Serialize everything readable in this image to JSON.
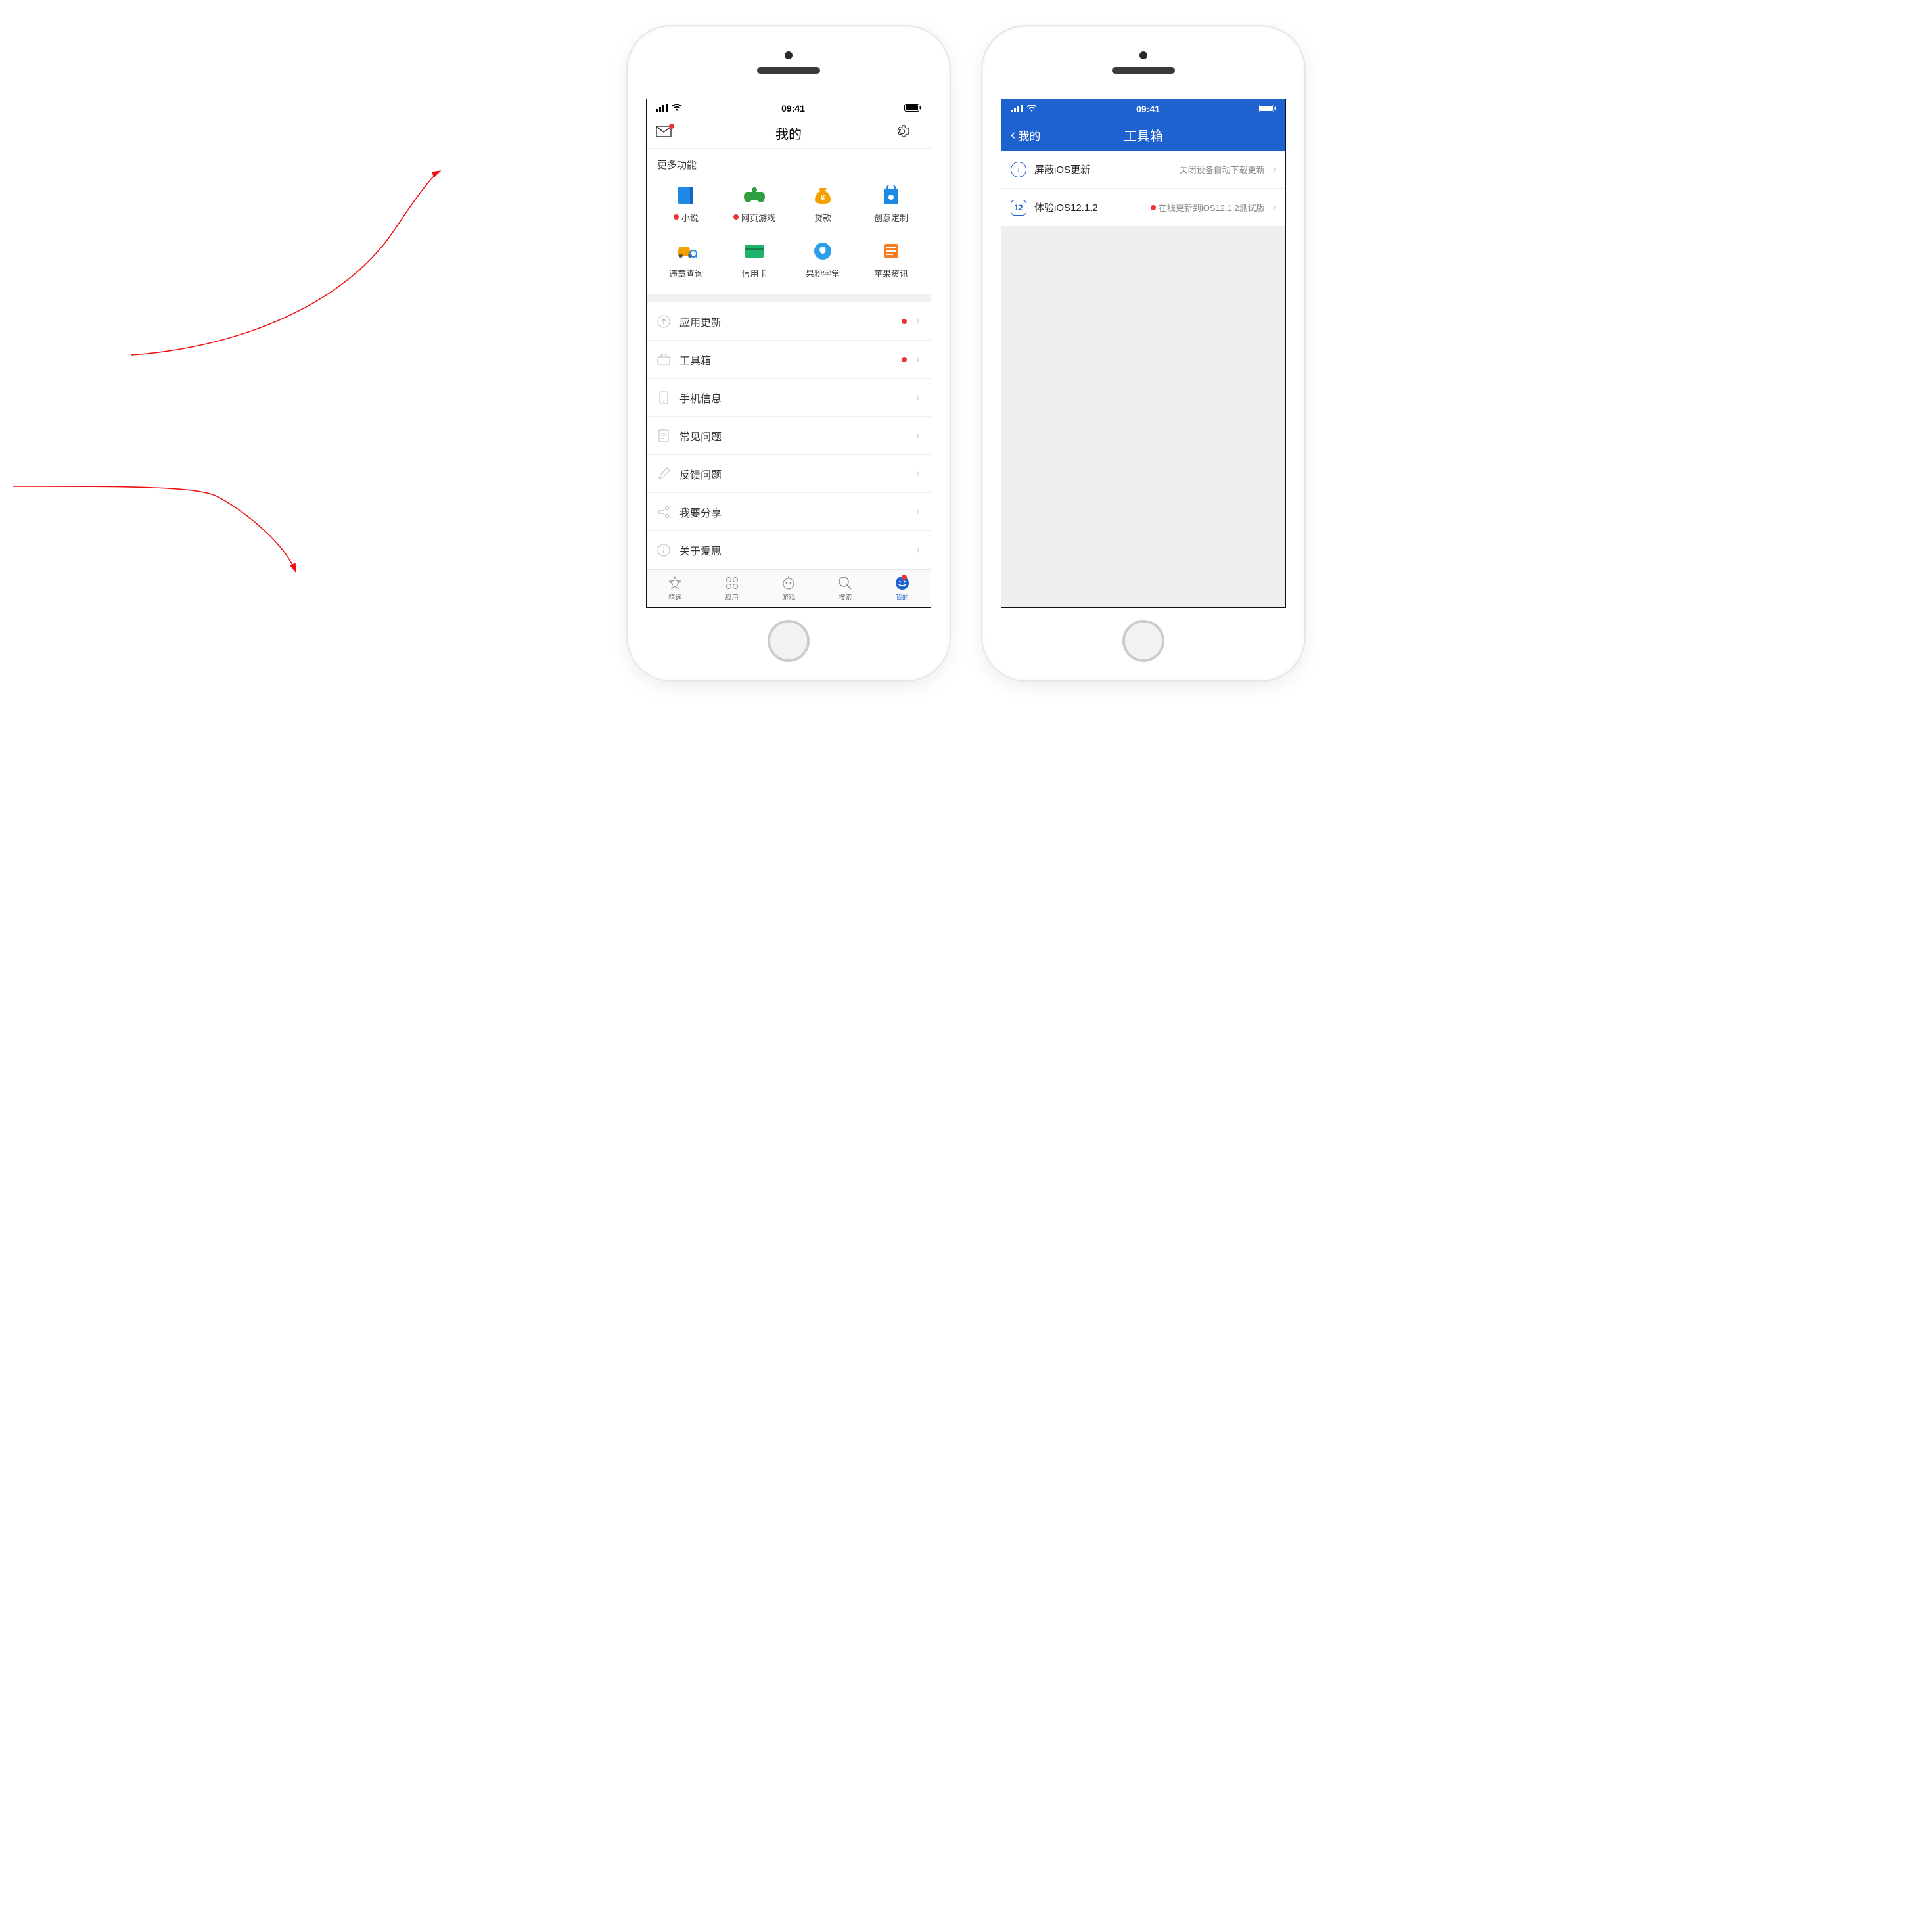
{
  "status": {
    "time": "09:41"
  },
  "left": {
    "nav": {
      "title": "我的"
    },
    "section_more": "更多功能",
    "grid": [
      {
        "label": "小说",
        "dot": true
      },
      {
        "label": "网页游戏",
        "dot": true
      },
      {
        "label": "贷款",
        "dot": false
      },
      {
        "label": "创意定制",
        "dot": false
      },
      {
        "label": "违章查询",
        "dot": false
      },
      {
        "label": "信用卡",
        "dot": false
      },
      {
        "label": "果粉学堂",
        "dot": false
      },
      {
        "label": "苹果资讯",
        "dot": false
      }
    ],
    "list": [
      {
        "label": "应用更新",
        "dot": true
      },
      {
        "label": "工具箱",
        "dot": true
      },
      {
        "label": "手机信息",
        "dot": false
      },
      {
        "label": "常见问题",
        "dot": false
      },
      {
        "label": "反馈问题",
        "dot": false
      },
      {
        "label": "我要分享",
        "dot": false
      },
      {
        "label": "关于爱思",
        "dot": false
      }
    ],
    "tabs": [
      {
        "label": "精选"
      },
      {
        "label": "应用"
      },
      {
        "label": "游戏"
      },
      {
        "label": "搜索"
      },
      {
        "label": "我的",
        "active": true,
        "dot": true
      }
    ]
  },
  "right": {
    "nav": {
      "back": "我的",
      "title": "工具箱"
    },
    "items": [
      {
        "title": "屏蔽iOS更新",
        "desc": "关闭设备自动下载更新",
        "dot": false,
        "icon": "↓"
      },
      {
        "title": "体验iOS12.1.2",
        "desc": "在线更新到iOS12.1.2测试版",
        "dot": true,
        "icon": "12"
      }
    ]
  }
}
